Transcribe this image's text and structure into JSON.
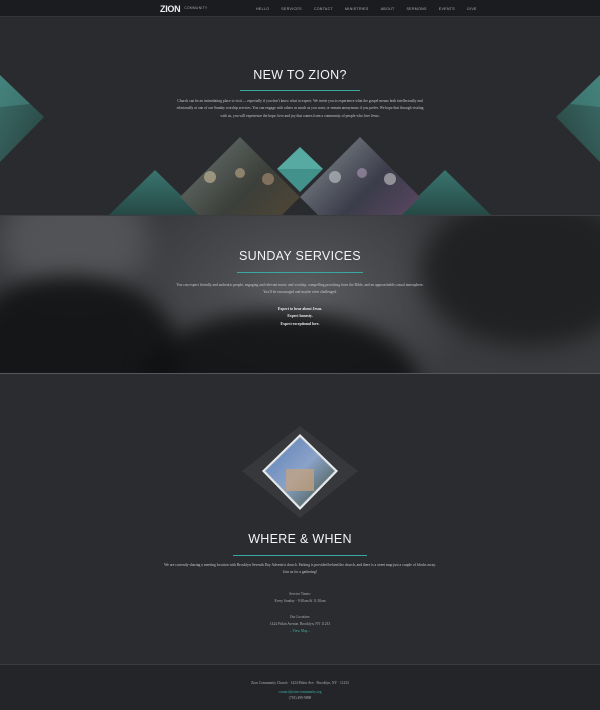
{
  "nav": {
    "logo_mark": "ZION",
    "logo_sub": "COMMUNITY",
    "items": [
      "HELLO",
      "SERVICES",
      "CONTACT",
      "MINISTRIES",
      "ABOUT",
      "SERMONS",
      "EVENTS",
      "GIVE"
    ]
  },
  "new_to_zion": {
    "title": "NEW TO ZION?",
    "body": "Church can be an intimidating place to visit — especially if you don't know what to expect. We invite you to experience what the gospel means both intellectually and relationally at one of our Sunday worship services. You can engage with others as much as you want, or remain anonymous if you prefer. We hope that through visiting with us, you will experience the hope, love and joy that comes from a community of people who love Jesus."
  },
  "sunday_services": {
    "title": "SUNDAY SERVICES",
    "body": "You can expect friendly and authentic people, engaging and relevant music and worship, compelling preaching from the Bible, and an approachable casual atmosphere. You'll be encouraged and maybe even challenged.",
    "expect_1": "Expect to hear about Jesus.",
    "expect_2": "Expect honesty.",
    "expect_3": "Expect exceptional love."
  },
  "where_when": {
    "title": "WHERE & WHEN",
    "body": "We are currently sharing a meeting location with Brooklyn Seventh Day Adventist church. Parking is provided behind the church, and there is a street map just a couple of blocks away. Join us for a gathering!",
    "times_label": "Service Times:",
    "times_value": "Every Sunday · 9:30am & 11:30am",
    "location_label": "Our Location:",
    "location_value": "1424 Pitkin Avenue, Brooklyn, NY 11233",
    "map_link": "– View Map –"
  },
  "footer": {
    "line1": "Zion Community Church · 1424 Pitkin Ave · Brooklyn, NY · 11233",
    "email": "contact@zion-community.org",
    "phone": "(718) 499-9898"
  },
  "colors": {
    "accent": "#3aa8a0",
    "background": "#2a2b2e",
    "nav": "#1b1c1f"
  }
}
